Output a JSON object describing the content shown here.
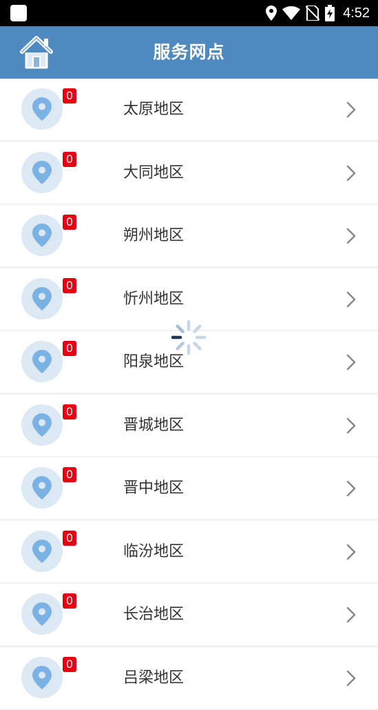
{
  "status_bar": {
    "time": "4:52",
    "icons": [
      "app-notification-icon",
      "location-icon",
      "wifi-icon",
      "no-sim-icon",
      "battery-charging-icon"
    ]
  },
  "header": {
    "title": "服务网点",
    "home_icon": "home-icon",
    "background": "#4e89c0"
  },
  "list": {
    "items": [
      {
        "label": "太原地区",
        "badge": "0"
      },
      {
        "label": "大同地区",
        "badge": "0"
      },
      {
        "label": "朔州地区",
        "badge": "0"
      },
      {
        "label": "忻州地区",
        "badge": "0"
      },
      {
        "label": "阳泉地区",
        "badge": "0"
      },
      {
        "label": "晋城地区",
        "badge": "0"
      },
      {
        "label": "晋中地区",
        "badge": "0"
      },
      {
        "label": "临汾地区",
        "badge": "0"
      },
      {
        "label": "长治地区",
        "badge": "0"
      },
      {
        "label": "吕梁地区",
        "badge": "0"
      }
    ],
    "item_icon": "location-pin-icon",
    "chevron_icon": "chevron-right-icon",
    "badge_color": "#e60012"
  },
  "loading": {
    "icon": "loading-spinner-icon"
  }
}
